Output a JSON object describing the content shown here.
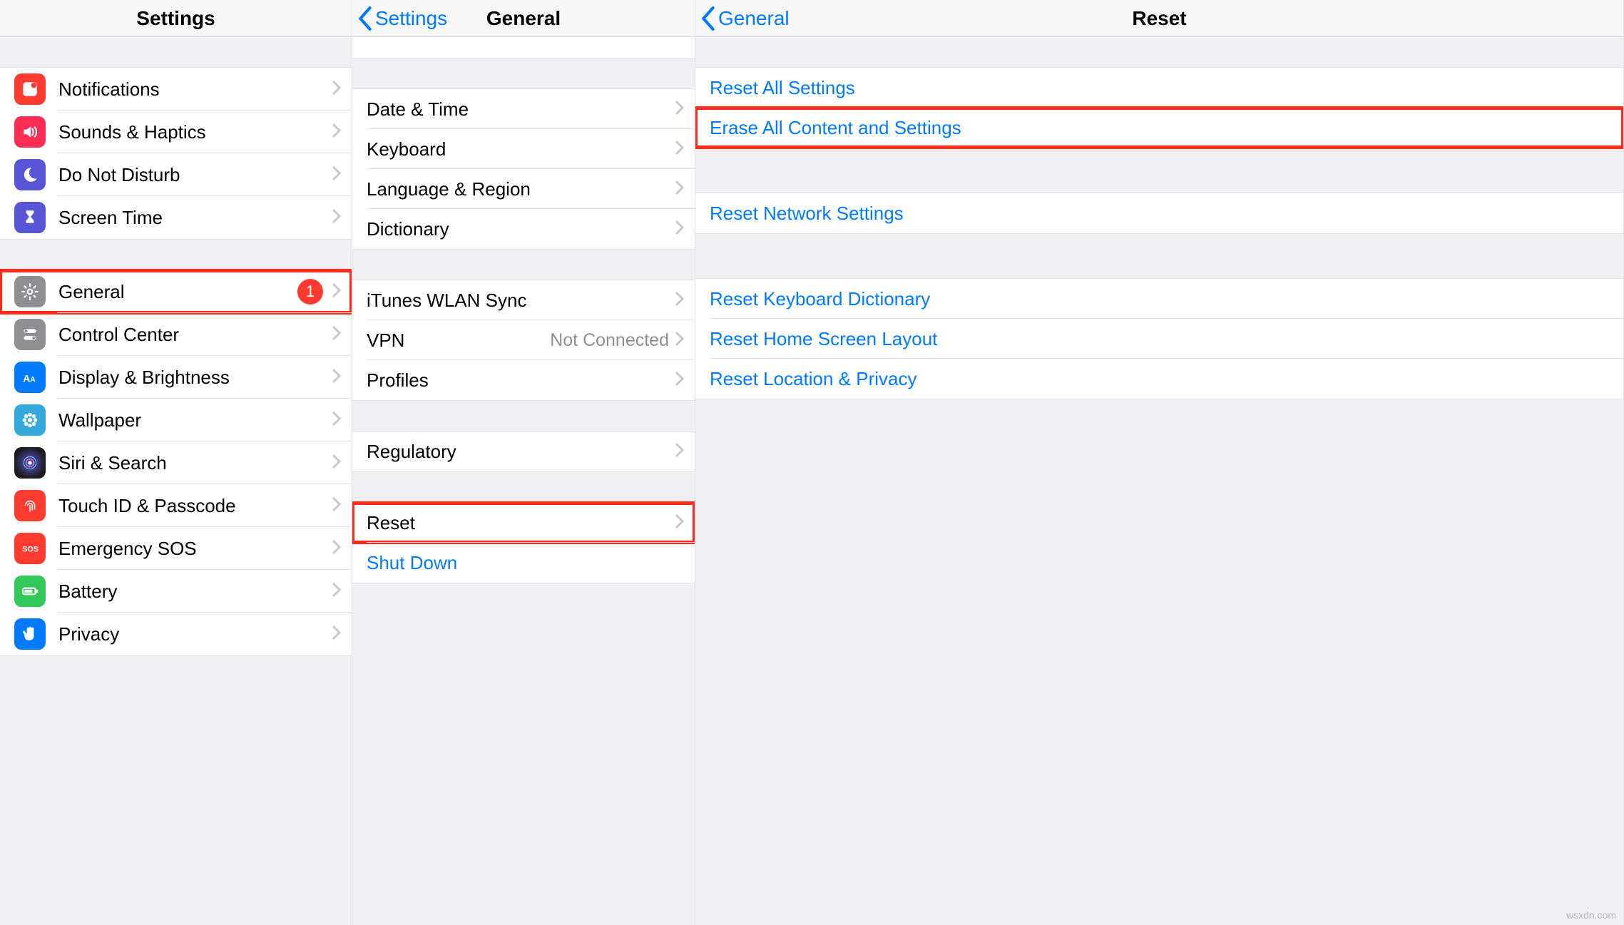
{
  "watermark": "wsxdn.com",
  "pane1": {
    "title": "Settings",
    "groups": [
      [
        {
          "id": "notifications",
          "label": "Notifications",
          "iconBg": "bg-red",
          "icon": "bell"
        },
        {
          "id": "sounds",
          "label": "Sounds & Haptics",
          "iconBg": "bg-pink",
          "icon": "speaker"
        },
        {
          "id": "dnd",
          "label": "Do Not Disturb",
          "iconBg": "bg-indigo",
          "icon": "moon"
        },
        {
          "id": "screentime",
          "label": "Screen Time",
          "iconBg": "bg-indigo",
          "icon": "hourglass"
        }
      ],
      [
        {
          "id": "general",
          "label": "General",
          "iconBg": "bg-gray",
          "icon": "gear",
          "badge": "1",
          "highlight": true
        },
        {
          "id": "controlcenter",
          "label": "Control Center",
          "iconBg": "bg-gray",
          "icon": "toggles"
        },
        {
          "id": "display",
          "label": "Display & Brightness",
          "iconBg": "bg-blue",
          "icon": "aa"
        },
        {
          "id": "wallpaper",
          "label": "Wallpaper",
          "iconBg": "bg-cyan",
          "icon": "flower"
        },
        {
          "id": "siri",
          "label": "Siri & Search",
          "iconBg": "bg-siri",
          "icon": "siri"
        },
        {
          "id": "touchid",
          "label": "Touch ID & Passcode",
          "iconBg": "bg-red",
          "icon": "fingerprint"
        },
        {
          "id": "sos",
          "label": "Emergency SOS",
          "iconBg": "bg-red",
          "icon": "sos"
        },
        {
          "id": "battery",
          "label": "Battery",
          "iconBg": "bg-green",
          "icon": "battery"
        },
        {
          "id": "privacy",
          "label": "Privacy",
          "iconBg": "bg-blue",
          "icon": "hand"
        }
      ]
    ]
  },
  "pane2": {
    "backLabel": "Settings",
    "title": "General",
    "groups": [
      [
        {
          "id": "datetime",
          "label": "Date & Time"
        },
        {
          "id": "keyboard",
          "label": "Keyboard"
        },
        {
          "id": "language",
          "label": "Language & Region"
        },
        {
          "id": "dictionary",
          "label": "Dictionary"
        }
      ],
      [
        {
          "id": "ituneswlan",
          "label": "iTunes WLAN Sync"
        },
        {
          "id": "vpn",
          "label": "VPN",
          "detail": "Not Connected"
        },
        {
          "id": "profiles",
          "label": "Profiles"
        }
      ],
      [
        {
          "id": "regulatory",
          "label": "Regulatory"
        }
      ],
      [
        {
          "id": "reset",
          "label": "Reset",
          "highlight": true
        },
        {
          "id": "shutdown",
          "label": "Shut Down",
          "link": true,
          "nochev": true
        }
      ]
    ]
  },
  "pane3": {
    "backLabel": "General",
    "title": "Reset",
    "groups": [
      [
        {
          "id": "resetall",
          "label": "Reset All Settings",
          "link": true
        },
        {
          "id": "eraseall",
          "label": "Erase All Content and Settings",
          "link": true,
          "highlight": true
        }
      ],
      [
        {
          "id": "resetnet",
          "label": "Reset Network Settings",
          "link": true
        }
      ],
      [
        {
          "id": "resetkbd",
          "label": "Reset Keyboard Dictionary",
          "link": true
        },
        {
          "id": "resethome",
          "label": "Reset Home Screen Layout",
          "link": true
        },
        {
          "id": "resetloc",
          "label": "Reset Location & Privacy",
          "link": true
        }
      ]
    ]
  }
}
